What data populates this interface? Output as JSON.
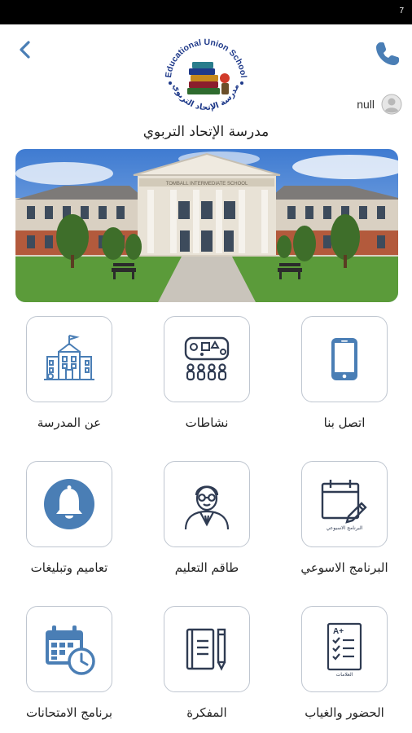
{
  "status": {
    "clock": "7"
  },
  "header": {
    "back_icon": "chevron-left-icon",
    "phone_icon": "phone-icon",
    "logo_text_top": "Educational Union School",
    "logo_text_bottom": "مدرسة الإتحاد التربوي",
    "user_name": "null",
    "avatar_icon": "user-avatar-icon"
  },
  "school": {
    "name": "مدرسة الإتحاد التربوي"
  },
  "banner": {
    "building_sign": "TOMBALL INTERMEDIATE SCHOOL",
    "alt": "school building photo"
  },
  "menu": {
    "items": [
      {
        "label": "اتصل بنا",
        "icon": "smartphone-icon"
      },
      {
        "label": "نشاطات",
        "icon": "activities-icon"
      },
      {
        "label": "عن المدرسة",
        "icon": "school-building-icon"
      },
      {
        "label": "البرنامج الاسوعي",
        "icon": "weekly-schedule-icon",
        "icon_caption": "البرنامج الاسبوعي"
      },
      {
        "label": "طاقم التعليم",
        "icon": "teacher-icon"
      },
      {
        "label": "تعاميم وتبليغات",
        "icon": "bell-icon"
      },
      {
        "label": "الحضور والغياب",
        "icon": "grades-sheet-icon",
        "icon_caption": "العلامات"
      },
      {
        "label": "المفكرة",
        "icon": "notebook-icon"
      },
      {
        "label": "برنامج الامتحانات",
        "icon": "exam-calendar-icon"
      }
    ]
  },
  "colors": {
    "accent": "#4a7eb5",
    "tile_border": "#bfc6d0",
    "dark_icon": "#2f3b52"
  }
}
